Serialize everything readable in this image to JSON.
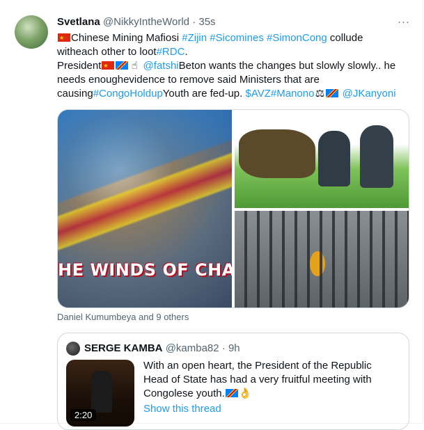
{
  "tweet": {
    "author_name": "Svetlana",
    "author_handle": "@NikkyIntheWorld",
    "time": "35s",
    "more_label": "···",
    "text": {
      "l1_a": "Chinese Mining Mafiosi ",
      "l1_tag1": "#Zijin",
      "l1_tag2": "#Sicomines",
      "l1_tag3": "#SimonCong",
      "l1_b": " collude",
      "l2_a": "witheach other to loot",
      "l2_tag": "#RDC",
      "l2_b": ".",
      "l3_a": "President",
      "l3_mention": "@fatshi",
      "l3_b": "Beton wants the changes but slowly slowly.. he",
      "l4": "needs enoughevidence to remove said Ministers that are",
      "l5_a": "causing",
      "l5_tag": "#CongoHoldup",
      "l5_b": "Youth are fed-up. ",
      "l5_cash": "$AVZ",
      "l5_tag2": "#Manono",
      "l5_mention": "@JKanyoni"
    },
    "media_caption": "HE WINDS OF CHANG",
    "liked_by": "Daniel Kumumbeya and 9 others"
  },
  "quote": {
    "author_name": "SERGE KAMBA",
    "author_handle": "@kamba82",
    "time": "9h",
    "duration": "2:20",
    "text_l1": "With an open heart, the President of the Republic",
    "text_l2": "Head of State has had a very fruitful meeting with",
    "text_l3": "Congolese youth.",
    "show_thread": "Show this thread"
  },
  "colors": {
    "link": "#1d9bf0",
    "muted": "#536471",
    "text": "#0f1419"
  },
  "icons": {
    "more": "more-icon",
    "flag_cn": "flag-china",
    "flag_cd": "flag-drc",
    "hand": "pointing-hand",
    "scales": "balance-scale",
    "ok": "ok-hand"
  }
}
